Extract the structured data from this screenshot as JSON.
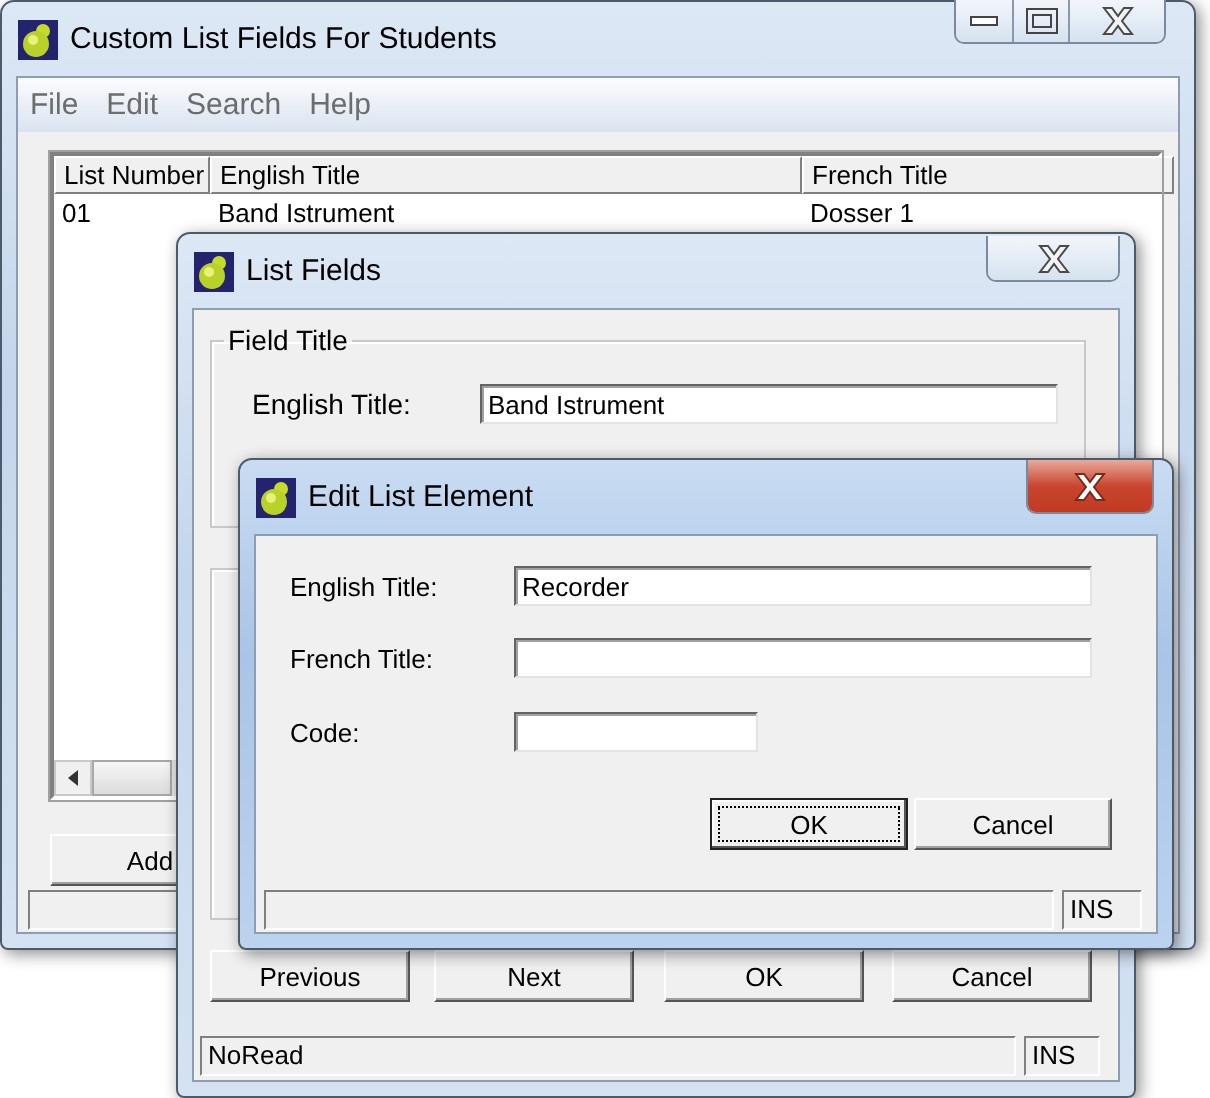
{
  "main_window": {
    "title": "Custom List Fields For Students",
    "active": false,
    "menu": [
      "File",
      "Edit",
      "Search",
      "Help"
    ],
    "table": {
      "columns": [
        "List Number",
        "English Title",
        "French Title"
      ],
      "rows": [
        [
          "01",
          "Band Istrument",
          "Dosser 1"
        ]
      ]
    },
    "buttons": [
      "Add"
    ]
  },
  "list_fields_dialog": {
    "title": "List Fields",
    "active": false,
    "group_title": "Field Title",
    "fields": [
      {
        "label": "English Title:",
        "value": "Band Istrument"
      }
    ],
    "buttons": [
      "Previous",
      "Next",
      "OK",
      "Cancel"
    ],
    "status_bar": {
      "message": "NoRead",
      "mode": "INS"
    }
  },
  "edit_dialog": {
    "title": "Edit List Element",
    "active": true,
    "fields": [
      {
        "label": "English Title:",
        "value": "Recorder"
      },
      {
        "label": "French Title:"
      },
      {
        "label": "Code:",
        "kind": "short"
      }
    ],
    "buttons": [
      {
        "label": "OK",
        "focused": true
      },
      {
        "label": "Cancel",
        "focused": false
      }
    ],
    "status_bar": {
      "mode": "INS"
    }
  }
}
